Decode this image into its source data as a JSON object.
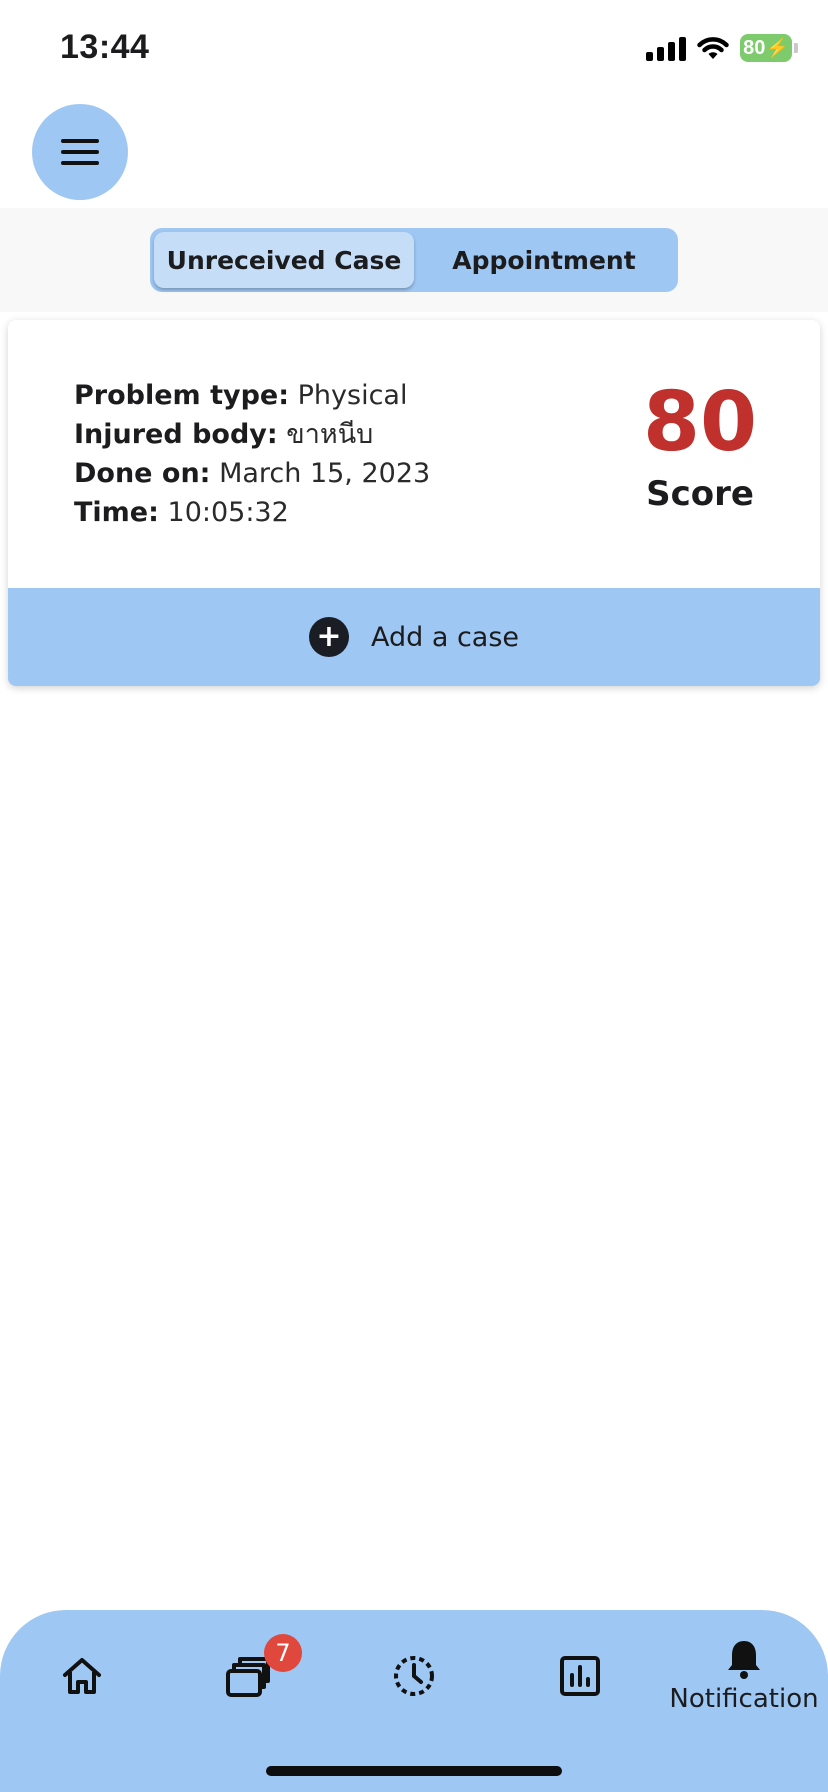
{
  "status_bar": {
    "time": "13:44",
    "battery": "80"
  },
  "menu": {
    "icon": "hamburger-menu-icon"
  },
  "tabs": [
    {
      "label": "Unreceived Case",
      "active": true
    },
    {
      "label": "Appointment",
      "active": false
    }
  ],
  "case_card": {
    "problem_type_label": "Problem type:",
    "problem_type_value": "Physical",
    "injured_body_label": "Injured body:",
    "injured_body_value": "ขาหนีบ",
    "done_on_label": "Done on:",
    "done_on_value": "March 15, 2023",
    "time_label": "Time:",
    "time_value": "10:05:32",
    "score_value": "80",
    "score_label": "Score",
    "score_color": "#c0302c"
  },
  "add_case": {
    "label": "Add a case",
    "icon": "plus-circle-icon"
  },
  "bottom_nav": {
    "items": [
      {
        "icon": "home-icon"
      },
      {
        "icon": "cases-icon",
        "badge": "7"
      },
      {
        "icon": "history-clock-icon"
      },
      {
        "icon": "chart-icon"
      },
      {
        "icon": "bell-icon",
        "label": "Notification"
      }
    ]
  },
  "colors": {
    "accent": "#9ec7f3",
    "badge": "#e0473d"
  }
}
